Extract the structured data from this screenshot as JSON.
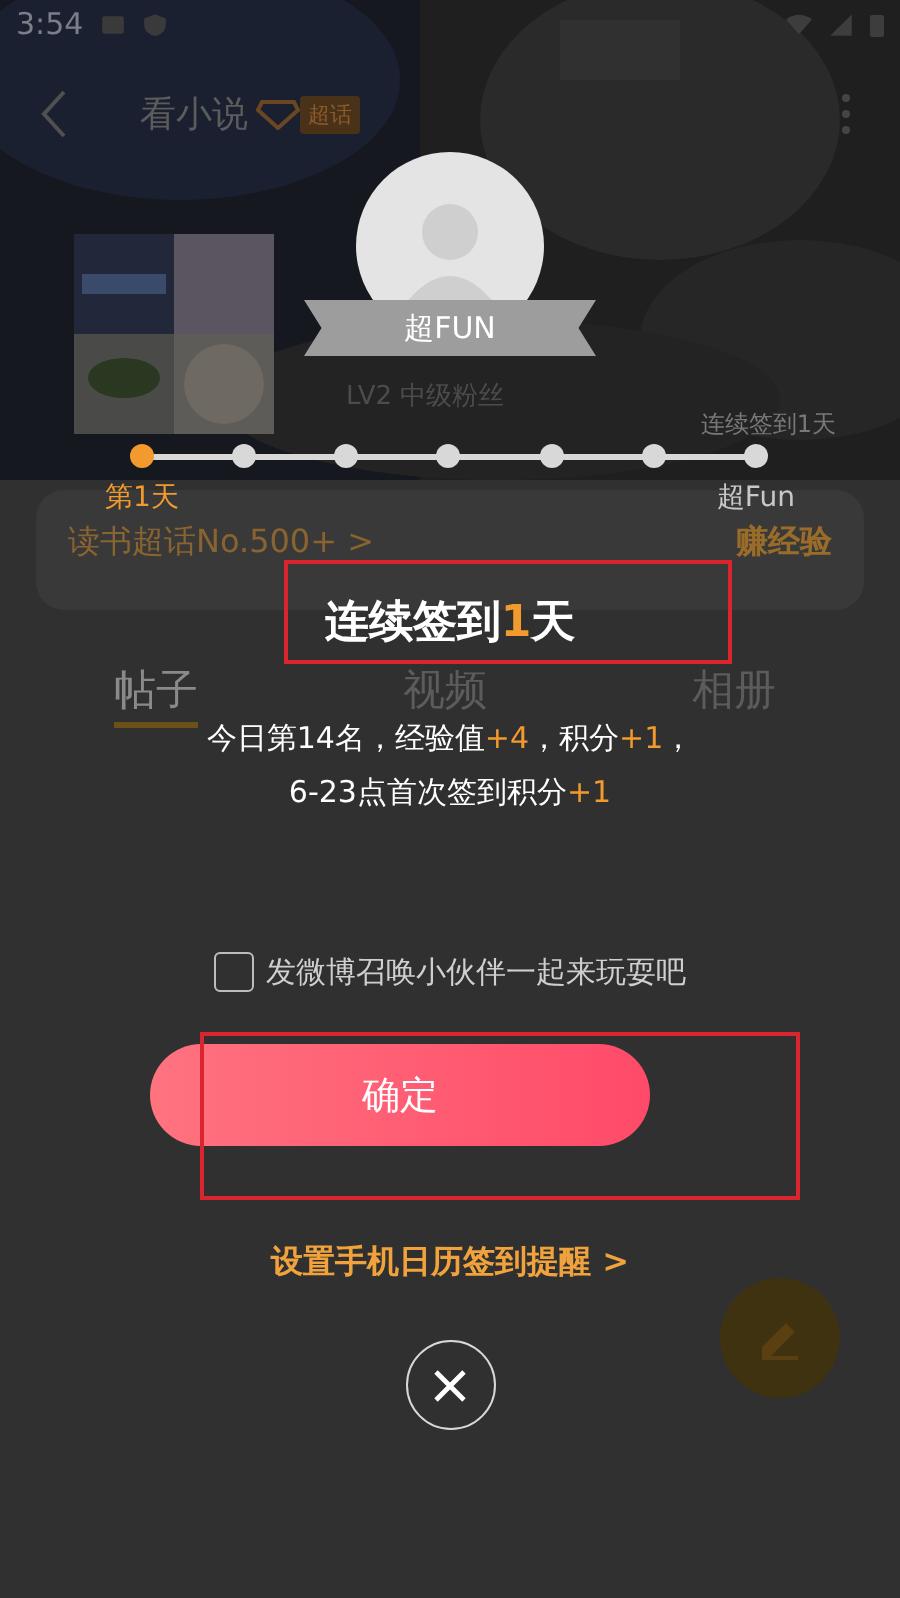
{
  "status_bar": {
    "time": "3:54"
  },
  "header": {
    "title": "看小说",
    "badge": "超话"
  },
  "profile": {
    "rank_label": "LV2 中级粉丝"
  },
  "topic_card": {
    "rank": "读书超话No.500+ >",
    "action": "赚经验"
  },
  "tabs": [
    {
      "label": "帖子",
      "selected": true
    },
    {
      "label": "视频",
      "selected": false
    },
    {
      "label": "相册",
      "selected": false
    }
  ],
  "dialog": {
    "avatar_badge": "超FUN",
    "streak_caption": "连续签到1天",
    "days": [
      {
        "label": "第1天",
        "reached": true
      },
      {
        "reached": false
      },
      {
        "reached": false
      },
      {
        "reached": false
      },
      {
        "reached": false
      },
      {
        "reached": false
      },
      {
        "label": "超Fun",
        "reached": false
      }
    ],
    "title": [
      {
        "text": "连续签到",
        "highlight": false
      },
      {
        "text": "1",
        "highlight": true
      },
      {
        "text": "天",
        "highlight": false
      }
    ],
    "reward_lines": [
      [
        {
          "text": "今日第14名，经验值",
          "highlight": false
        },
        {
          "text": "+4",
          "highlight": true
        },
        {
          "text": "，积分",
          "highlight": false
        },
        {
          "text": "+1",
          "highlight": true
        },
        {
          "text": "，",
          "highlight": false
        }
      ],
      [
        {
          "text": "6-23点首次签到积分",
          "highlight": false
        },
        {
          "text": "+1",
          "highlight": true
        }
      ]
    ],
    "share_checkbox": {
      "label": "发微博召唤小伙伴一起来玩耍吧",
      "checked": false
    },
    "confirm_button": "确定",
    "calendar_link": "设置手机日历签到提醒 >"
  }
}
